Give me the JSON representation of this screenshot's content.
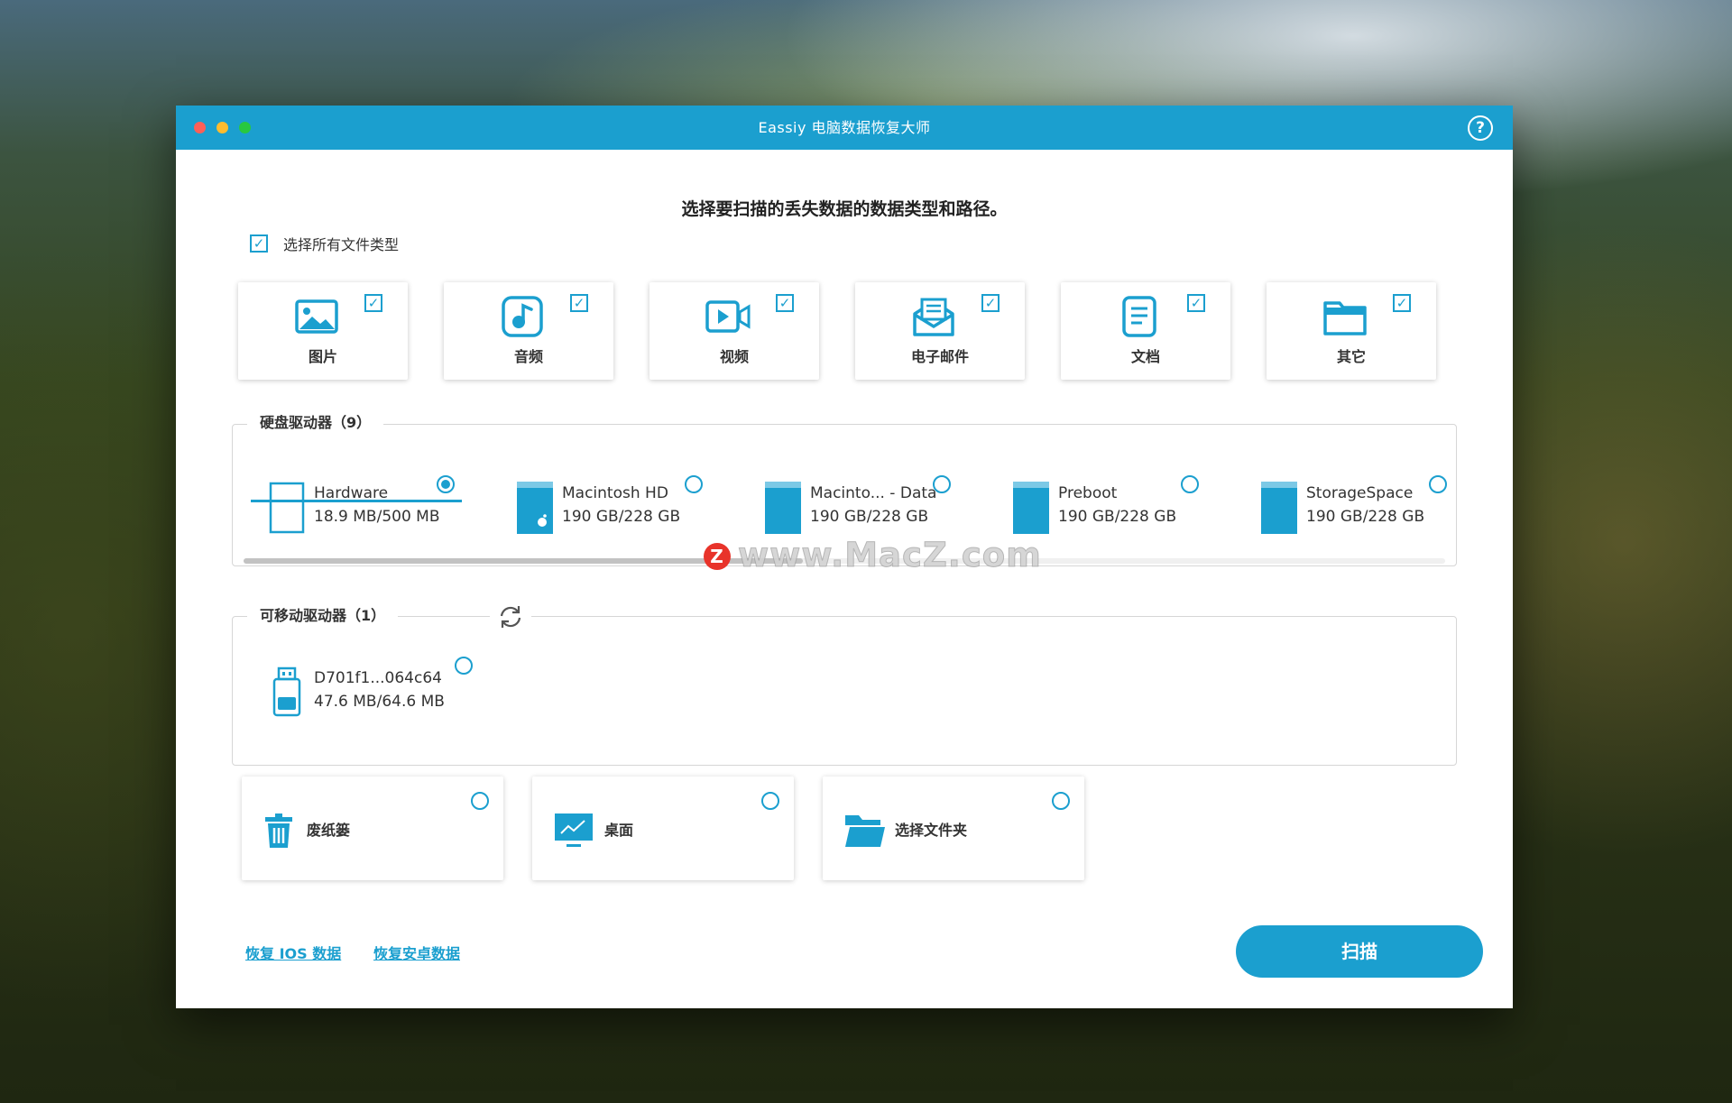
{
  "window": {
    "title": "Eassiy 电脑数据恢复大师",
    "help_label": "?"
  },
  "heading": "选择要扫描的丢失数据的数据类型和路径。",
  "select_all": {
    "label": "选择所有文件类型",
    "checked": true
  },
  "file_types": [
    {
      "label": "图片",
      "icon": "image-icon",
      "checked": true
    },
    {
      "label": "音频",
      "icon": "music-icon",
      "checked": true
    },
    {
      "label": "视频",
      "icon": "video-icon",
      "checked": true
    },
    {
      "label": "电子邮件",
      "icon": "email-icon",
      "checked": true
    },
    {
      "label": "文档",
      "icon": "document-icon",
      "checked": true
    },
    {
      "label": "其它",
      "icon": "folder-icon",
      "checked": true
    }
  ],
  "hard_drives": {
    "label": "硬盘驱动器（9）",
    "items": [
      {
        "name": "Hardware",
        "size": "18.9 MB/500 MB",
        "selected": true
      },
      {
        "name": "Macintosh HD",
        "size": "190 GB/228 GB",
        "selected": false
      },
      {
        "name": "Macinto... - Data",
        "size": "190 GB/228 GB",
        "selected": false
      },
      {
        "name": "Preboot",
        "size": "190 GB/228 GB",
        "selected": false
      },
      {
        "name": "StorageSpace",
        "size": "190 GB/228 GB",
        "selected": false
      }
    ]
  },
  "removable_drives": {
    "label": "可移动驱动器（1）",
    "items": [
      {
        "name": "D701f1...064c64",
        "size": "47.6 MB/64.6 MB",
        "selected": false
      }
    ]
  },
  "locations": [
    {
      "label": "废纸篓",
      "icon": "trash-icon",
      "selected": false
    },
    {
      "label": "桌面",
      "icon": "desktop-icon",
      "selected": false
    },
    {
      "label": "选择文件夹",
      "icon": "folder-open-icon",
      "selected": false
    }
  ],
  "links": {
    "ios": "恢复 IOS 数据",
    "android": "恢复安卓数据"
  },
  "scan_button": "扫描",
  "watermark": {
    "badge": "Z",
    "text": "www.MacZ.com"
  },
  "colors": {
    "accent": "#1b9fcf",
    "title_bar": "#1b9fcf",
    "traffic_red": "#fe5f57",
    "traffic_yellow": "#febc2e",
    "traffic_green": "#28c840"
  }
}
